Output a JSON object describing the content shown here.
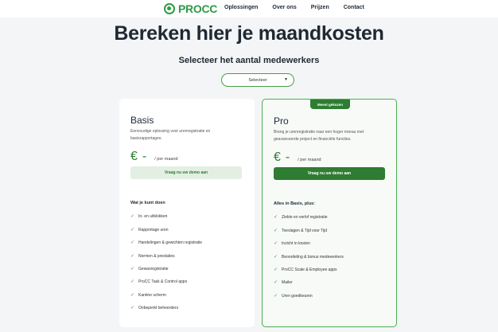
{
  "nav": {
    "logo_text": "PROCC",
    "links": [
      "Oplossingen",
      "Over ons",
      "Prijzen",
      "Contact"
    ]
  },
  "title": "Bereken hier je maandkosten",
  "subtitle": "Selecteer het aantal medewerkers",
  "select": {
    "value": "Selecteer"
  },
  "plans": {
    "basis": {
      "name": "Basis",
      "description": "Eenvoudige oplossing voor urenregistratie en basisrapportages.",
      "currency": "€",
      "price": "-",
      "period": "/ per maand",
      "cta": "Vraag nu uw demo aan",
      "features_title": "Wat je kunt doen",
      "features": [
        "In- en uitklokken",
        "Rapportage uren",
        "Handelingen & gewichten registratie",
        "Normen & prestaties",
        "Gewasregistratie",
        "ProCC Task & Control apps",
        "Kantine scherm",
        "Onbeperkt beheerders"
      ]
    },
    "pro": {
      "badge": "Meest gekozen",
      "name": "Pro",
      "description": "Breng je urenregistratie naar een hoger niveau met geavanceerde project en financiële functies.",
      "currency": "€",
      "price": "-",
      "period": "/ per maand",
      "cta": "Vraag nu uw demo aan",
      "features_title": "Alles in Basis, plus:",
      "features": [
        "Ziekte en verlof registratie",
        "Toeslagen & Tijd voor Tijd",
        "Inzicht in kosten",
        "Beoordeling & bonus medewerkers",
        "ProCC Scale & Employee apps",
        "Mailer",
        "Uren goedkeuren"
      ]
    }
  },
  "colors": {
    "brand_green": "#2e7d32",
    "light_green": "#e3efe3",
    "background": "#f4f5f7"
  }
}
